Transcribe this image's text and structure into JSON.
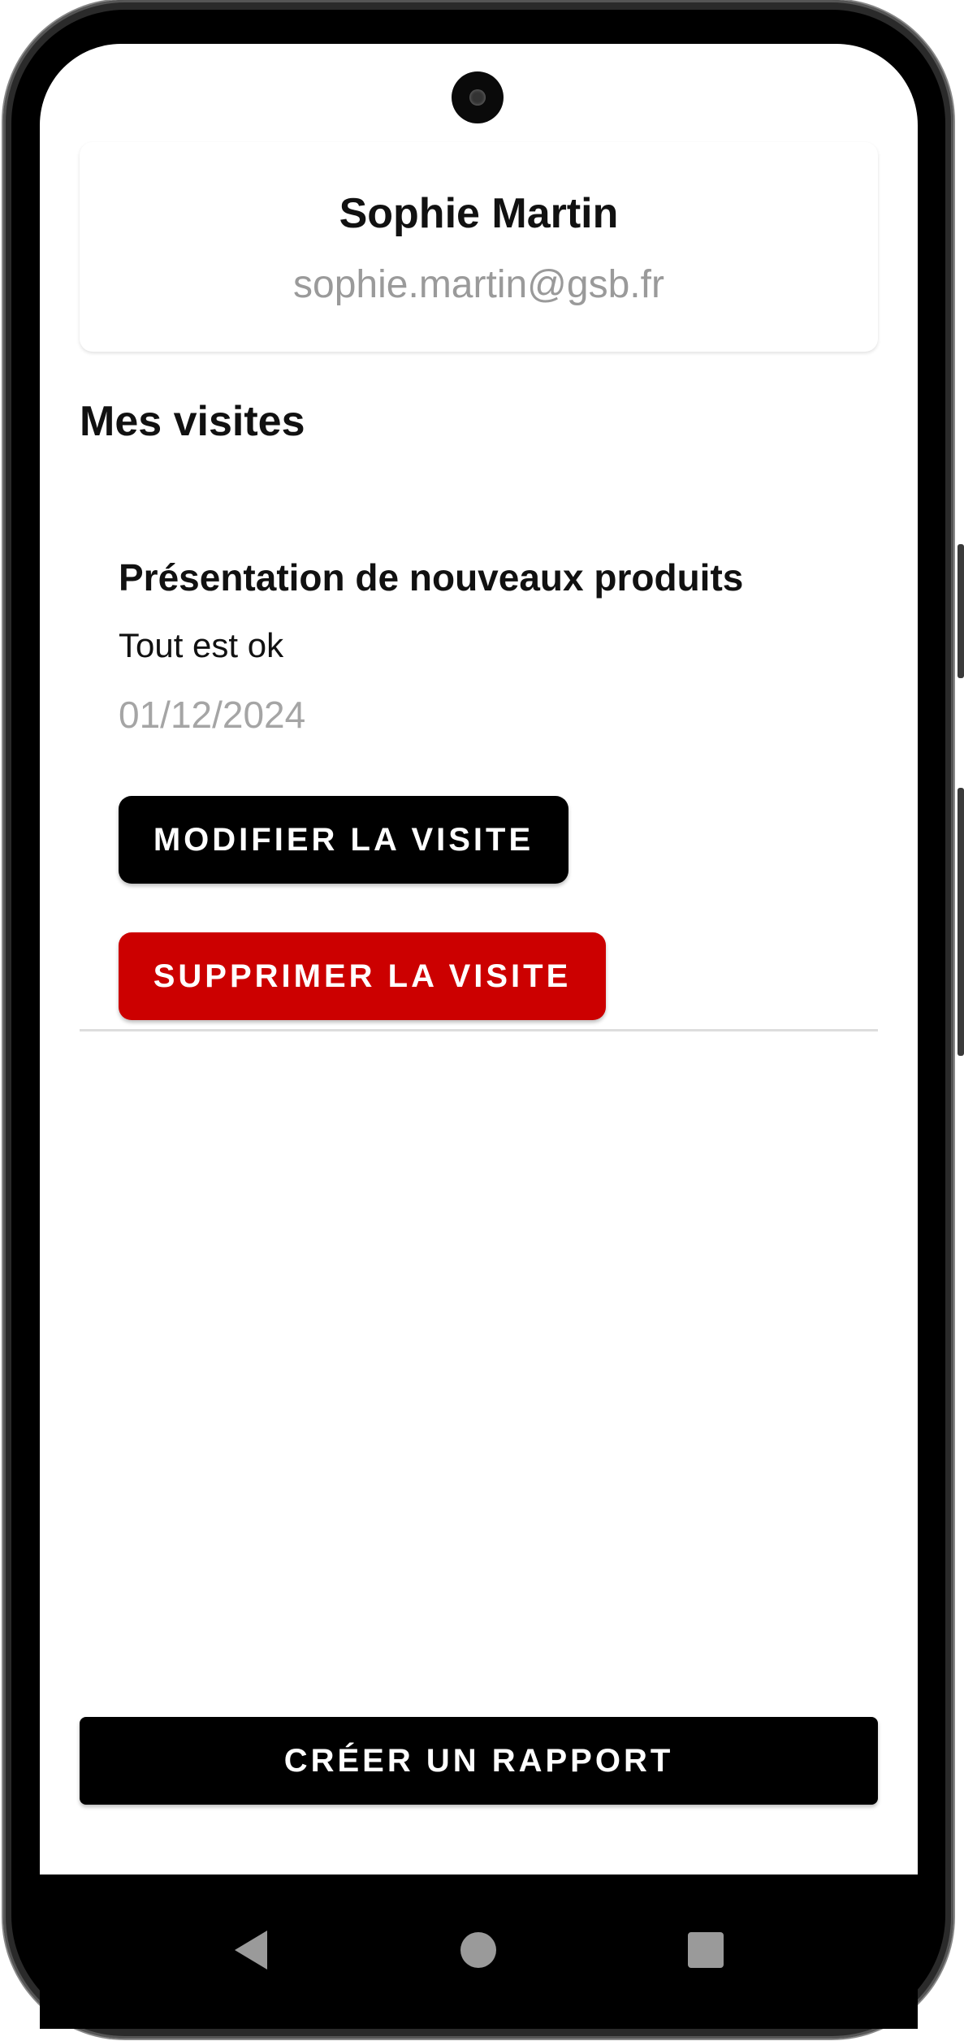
{
  "profile": {
    "name": "Sophie Martin",
    "email": "sophie.martin@gsb.fr"
  },
  "visits_section": {
    "title": "Mes visites",
    "items": [
      {
        "title": "Présentation de nouveaux produits",
        "description": "Tout est ok",
        "date": "01/12/2024",
        "edit_label": "MODIFIER LA VISITE",
        "delete_label": "SUPPRIMER LA VISITE"
      }
    ]
  },
  "actions": {
    "create_report_label": "CRÉER UN RAPPORT"
  },
  "nav_bar": {
    "back_icon": "back-triangle-icon",
    "home_icon": "home-circle-icon",
    "recents_icon": "recents-square-icon"
  },
  "colors": {
    "primary_button": "#000000",
    "danger_button": "#cc0000",
    "muted_text": "#9a9a9a"
  }
}
